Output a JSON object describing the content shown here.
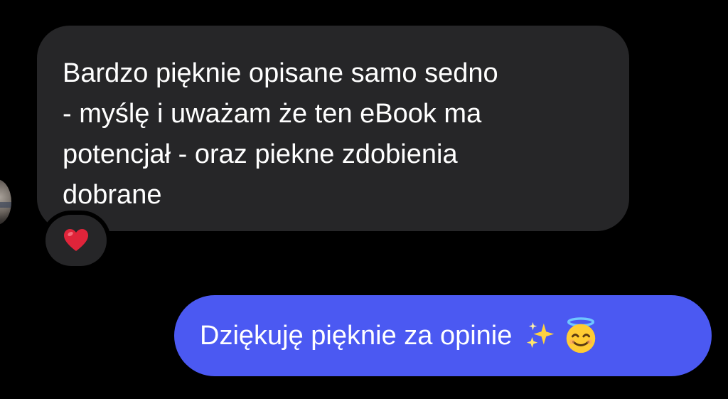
{
  "messages": [
    {
      "direction": "incoming",
      "text": "Bardzo pięknie opisane samo sedno\n- myślę i uważam że ten eBook ma\npotencjał - oraz piekne zdobienia\ndobrane",
      "reaction": "heart-emoji"
    },
    {
      "direction": "outgoing",
      "text": "Dziękuję pięknie za opinie",
      "trailing_emojis": [
        "sparkles-emoji",
        "smiling-face-with-halo-emoji"
      ]
    }
  ],
  "colors": {
    "background": "#000000",
    "incoming_bubble": "#262628",
    "outgoing_bubble": "#4b59f2",
    "text": "#ffffff",
    "heart": "#e0243a"
  }
}
